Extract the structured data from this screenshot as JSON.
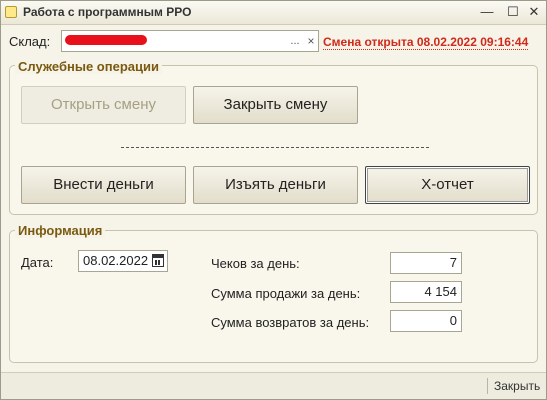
{
  "window": {
    "title": "Работа с программным РРО",
    "minimize_glyph": "—",
    "maximize_glyph": "☐",
    "close_glyph": "✕"
  },
  "warehouse": {
    "label": "Склад:",
    "value_redacted": true,
    "select_glyph": "...",
    "clear_glyph": "×"
  },
  "shift_status": "Смена открыта 08.02.2022 09:16:44",
  "service_ops": {
    "title": "Служебные операции",
    "open_shift": "Открыть смену",
    "open_shift_enabled": false,
    "close_shift": "Закрыть смену",
    "deposit": "Внести деньги",
    "withdraw": "Изъять деньги",
    "x_report": "X-отчет"
  },
  "info": {
    "title": "Информация",
    "date_label": "Дата:",
    "date_value": "08.02.2022",
    "checks_label": "Чеков за день:",
    "checks_value": "7",
    "sales_label": "Сумма продажи за день:",
    "sales_value": "4 154",
    "returns_label": "Сумма возвратов за день:",
    "returns_value": "0"
  },
  "footer": {
    "close_label": "Закрыть"
  },
  "colors": {
    "status_red": "#d12a1a",
    "group_title": "#7a5a10",
    "background": "#f6f3e8"
  }
}
